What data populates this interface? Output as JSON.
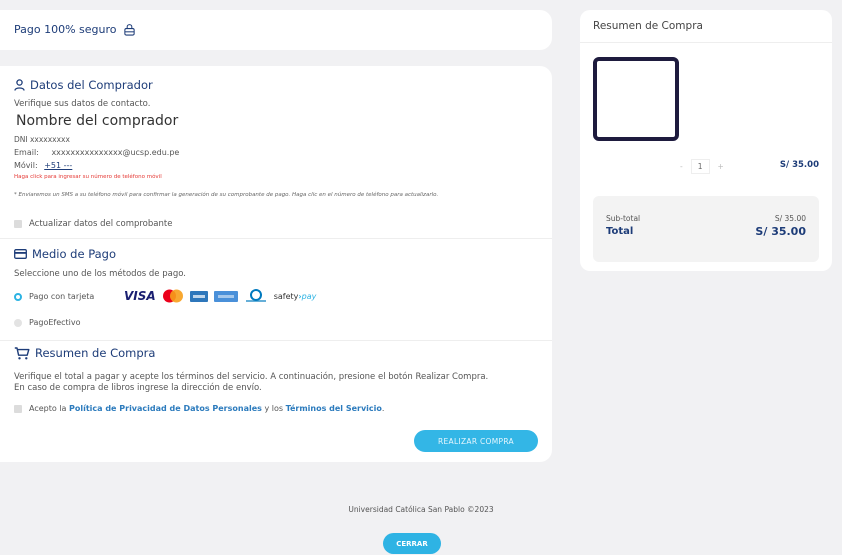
{
  "secure_bar": {
    "label": "Pago 100% seguro",
    "icon": "lock-icon"
  },
  "buyer": {
    "title": "Datos del Comprador",
    "icon": "user-icon",
    "verify": "Verifique sus datos de contacto.",
    "name": "Nombre del comprador",
    "dni": "DNI  xxxxxxxxx",
    "email_label": "Email:",
    "email_value": "xxxxxxxxxxxxxxx@ucsp.edu.pe",
    "mobile_label": "Móvil:",
    "mobile_value": "+51 ---",
    "mobile_hint": "Haga click para ingresar su número de teléfono móvil",
    "sms_note": "* Enviaremos un SMS a su teléfono móvil para confirmar la generación de su comprobante de pago. Haga clic en el número de teléfono para actualizarlo.",
    "update_label": "Actualizar datos del comprobante"
  },
  "payment": {
    "title": "Medio de Pago",
    "icon": "credit-card-icon",
    "instruction": "Seleccione uno de los métodos de pago.",
    "options": [
      {
        "label": "Pago con tarjeta",
        "selected": true
      },
      {
        "label": "PagoEfectivo",
        "selected": false
      }
    ],
    "brands": [
      "VISA",
      "safety",
      "pay"
    ]
  },
  "summary_section": {
    "title": "Resumen de Compra",
    "icon": "cart-icon",
    "text1": "Verifique el total a pagar y acepte los términos del servicio. A continuación, presione el botón Realizar Compra.",
    "text2": "En caso de compra de libros ingrese la dirección de envío.",
    "accept_prefix": "Acepto la ",
    "privacy_link": "Política de Privacidad de Datos Personales",
    "accept_mid": " y los ",
    "terms_link": "Términos del Servicio",
    "accept_suffix": ".",
    "submit": "REALIZAR COMPRA"
  },
  "order_summary": {
    "title": "Resumen de Compra",
    "qty_minus": "-",
    "qty": "1",
    "qty_plus": "+",
    "price": "S/ 35.00",
    "subtotal_label": "Sub-total",
    "subtotal_value": "S/ 35.00",
    "total_label": "Total",
    "total_value": "S/ 35.00"
  },
  "footer": {
    "text": "Universidad Católica San Pablo ©2023",
    "close": "CERRAR"
  },
  "colors": {
    "accent": "#2cb3e3",
    "heading": "#1d3c78",
    "background": "#f1f1f3"
  }
}
